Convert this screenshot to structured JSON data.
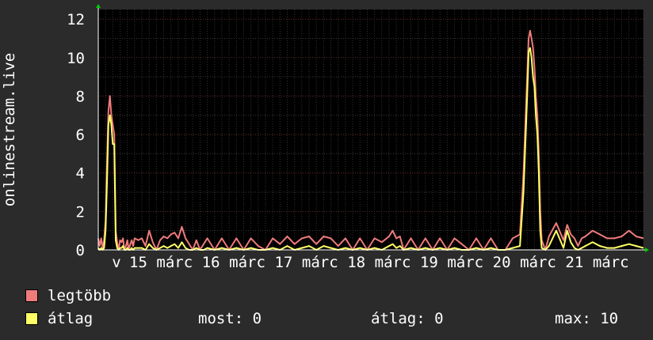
{
  "chart_data": {
    "type": "area",
    "ylabel": "onlinestream.live",
    "ylim": [
      0,
      12.5
    ],
    "yticks": [
      0,
      2,
      4,
      6,
      8,
      10,
      12
    ],
    "xrange": [
      0,
      7.5
    ],
    "xticks": [
      {
        "x": 0.25,
        "label": "v"
      },
      {
        "x": 0.55,
        "label": "15"
      },
      {
        "x": 1.05,
        "label": "márc"
      },
      {
        "x": 1.55,
        "label": "16"
      },
      {
        "x": 2.05,
        "label": "márc"
      },
      {
        "x": 2.55,
        "label": "17"
      },
      {
        "x": 3.05,
        "label": "márc"
      },
      {
        "x": 3.55,
        "label": "18"
      },
      {
        "x": 4.05,
        "label": "márc"
      },
      {
        "x": 4.55,
        "label": "19"
      },
      {
        "x": 5.05,
        "label": "márc"
      },
      {
        "x": 5.55,
        "label": "20"
      },
      {
        "x": 6.05,
        "label": "márc"
      },
      {
        "x": 6.55,
        "label": "21"
      },
      {
        "x": 7.05,
        "label": "márc"
      }
    ],
    "grid": true,
    "series": [
      {
        "name": "legtöbb",
        "color": "#f07b7b",
        "x": [
          0.0,
          0.02,
          0.04,
          0.06,
          0.08,
          0.1,
          0.12,
          0.14,
          0.16,
          0.18,
          0.2,
          0.22,
          0.24,
          0.26,
          0.28,
          0.3,
          0.32,
          0.34,
          0.36,
          0.38,
          0.4,
          0.42,
          0.44,
          0.46,
          0.48,
          0.5,
          0.55,
          0.6,
          0.65,
          0.7,
          0.75,
          0.8,
          0.85,
          0.9,
          0.95,
          1.0,
          1.05,
          1.1,
          1.15,
          1.2,
          1.25,
          1.3,
          1.35,
          1.4,
          1.45,
          1.5,
          1.6,
          1.7,
          1.8,
          1.9,
          2.0,
          2.1,
          2.2,
          2.3,
          2.4,
          2.5,
          2.6,
          2.7,
          2.8,
          2.9,
          3.0,
          3.1,
          3.2,
          3.3,
          3.4,
          3.5,
          3.6,
          3.7,
          3.8,
          3.9,
          4.0,
          4.05,
          4.1,
          4.15,
          4.2,
          4.3,
          4.4,
          4.5,
          4.6,
          4.7,
          4.8,
          4.9,
          5.0,
          5.1,
          5.2,
          5.3,
          5.4,
          5.5,
          5.6,
          5.7,
          5.8,
          5.85,
          5.9,
          5.92,
          5.94,
          5.96,
          5.98,
          6.0,
          6.02,
          6.04,
          6.06,
          6.08,
          6.1,
          6.15,
          6.2,
          6.3,
          6.4,
          6.45,
          6.5,
          6.55,
          6.6,
          6.65,
          6.7,
          6.8,
          6.9,
          7.0,
          7.1,
          7.2,
          7.3,
          7.4,
          7.5
        ],
        "values": [
          0.6,
          0.2,
          0.6,
          0.1,
          0.5,
          1.5,
          4.5,
          7.2,
          8.0,
          7.0,
          6.5,
          6.0,
          1.0,
          0.4,
          0.0,
          0.5,
          0.4,
          0.6,
          0.0,
          0.2,
          0.5,
          0.0,
          0.3,
          0.5,
          0.2,
          0.6,
          0.5,
          0.6,
          0.2,
          1.0,
          0.4,
          0.0,
          0.5,
          0.7,
          0.6,
          0.8,
          0.9,
          0.6,
          1.2,
          0.6,
          0.3,
          0.0,
          0.5,
          0.0,
          0.3,
          0.6,
          0.0,
          0.6,
          0.0,
          0.6,
          0.0,
          0.6,
          0.2,
          0.0,
          0.6,
          0.3,
          0.7,
          0.3,
          0.6,
          0.7,
          0.3,
          0.7,
          0.6,
          0.2,
          0.6,
          0.0,
          0.6,
          0.0,
          0.6,
          0.4,
          0.7,
          1.0,
          0.6,
          0.7,
          0.0,
          0.6,
          0.0,
          0.6,
          0.0,
          0.6,
          0.0,
          0.6,
          0.3,
          0.0,
          0.6,
          0.0,
          0.6,
          0.0,
          0.0,
          0.6,
          0.8,
          4.0,
          9.0,
          11.0,
          11.4,
          11.0,
          10.5,
          9.5,
          8.0,
          7.0,
          5.0,
          2.0,
          0.5,
          0.0,
          0.7,
          1.4,
          0.5,
          1.3,
          0.8,
          0.6,
          0.2,
          0.6,
          0.7,
          1.0,
          0.8,
          0.6,
          0.6,
          0.7,
          1.0,
          0.7,
          0.6
        ]
      },
      {
        "name": "átlag",
        "color": "#ffff66",
        "x": [
          0.0,
          0.02,
          0.04,
          0.06,
          0.08,
          0.1,
          0.12,
          0.14,
          0.16,
          0.18,
          0.2,
          0.22,
          0.24,
          0.26,
          0.28,
          0.3,
          0.32,
          0.34,
          0.36,
          0.38,
          0.4,
          0.42,
          0.44,
          0.46,
          0.48,
          0.5,
          0.55,
          0.6,
          0.65,
          0.7,
          0.75,
          0.8,
          0.85,
          0.9,
          0.95,
          1.0,
          1.05,
          1.1,
          1.15,
          1.2,
          1.25,
          1.3,
          1.35,
          1.4,
          1.45,
          1.5,
          1.6,
          1.7,
          1.8,
          1.9,
          2.0,
          2.1,
          2.2,
          2.3,
          2.4,
          2.5,
          2.6,
          2.7,
          2.8,
          2.9,
          3.0,
          3.1,
          3.2,
          3.3,
          3.4,
          3.5,
          3.6,
          3.7,
          3.8,
          3.9,
          4.0,
          4.05,
          4.1,
          4.15,
          4.2,
          4.3,
          4.4,
          4.5,
          4.6,
          4.7,
          4.8,
          4.9,
          5.0,
          5.1,
          5.2,
          5.3,
          5.4,
          5.5,
          5.6,
          5.7,
          5.8,
          5.85,
          5.9,
          5.92,
          5.94,
          5.96,
          5.98,
          6.0,
          6.02,
          6.04,
          6.06,
          6.08,
          6.1,
          6.15,
          6.2,
          6.3,
          6.4,
          6.45,
          6.5,
          6.55,
          6.6,
          6.65,
          6.7,
          6.8,
          6.9,
          7.0,
          7.1,
          7.2,
          7.3,
          7.4,
          7.5
        ],
        "values": [
          0.1,
          0.0,
          0.1,
          0.0,
          0.1,
          1.0,
          3.5,
          6.5,
          7.0,
          6.5,
          5.5,
          5.5,
          0.5,
          0.1,
          0.0,
          0.1,
          0.1,
          0.2,
          0.0,
          0.0,
          0.1,
          0.0,
          0.0,
          0.1,
          0.0,
          0.1,
          0.1,
          0.1,
          0.0,
          0.3,
          0.1,
          0.0,
          0.1,
          0.2,
          0.1,
          0.2,
          0.3,
          0.1,
          0.4,
          0.1,
          0.0,
          0.0,
          0.1,
          0.0,
          0.0,
          0.1,
          0.0,
          0.1,
          0.0,
          0.1,
          0.0,
          0.1,
          0.0,
          0.0,
          0.1,
          0.0,
          0.2,
          0.0,
          0.1,
          0.2,
          0.0,
          0.2,
          0.1,
          0.0,
          0.1,
          0.0,
          0.1,
          0.0,
          0.1,
          0.0,
          0.2,
          0.3,
          0.1,
          0.2,
          0.0,
          0.1,
          0.0,
          0.1,
          0.0,
          0.1,
          0.0,
          0.1,
          0.0,
          0.0,
          0.1,
          0.0,
          0.1,
          0.0,
          0.0,
          0.1,
          0.2,
          3.0,
          8.0,
          10.3,
          10.5,
          10.0,
          9.0,
          8.5,
          7.0,
          6.0,
          4.0,
          1.0,
          0.1,
          0.0,
          0.2,
          1.0,
          0.1,
          1.0,
          0.4,
          0.1,
          0.0,
          0.1,
          0.2,
          0.4,
          0.2,
          0.1,
          0.1,
          0.2,
          0.3,
          0.2,
          0.1
        ]
      }
    ]
  },
  "legend": {
    "max_label": "legtöbb",
    "avg_label": "átlag",
    "max_color": "#f07b7b",
    "avg_color": "#ffff66"
  },
  "stats": {
    "now": "most: 0",
    "avg": "átlag: 0",
    "max": "max: 10"
  }
}
